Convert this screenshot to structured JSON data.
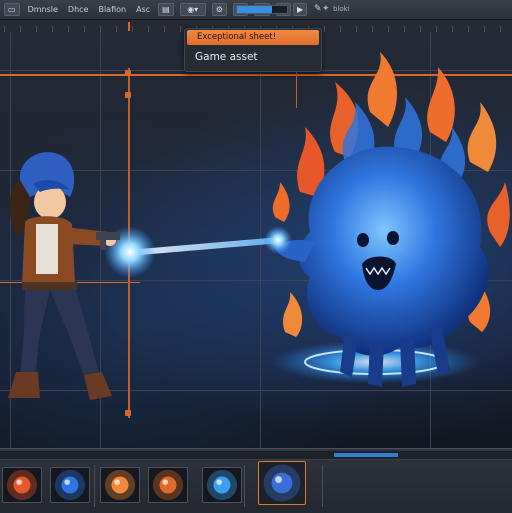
{
  "toolbar": {
    "menu_items": [
      "Dmnsle",
      "Dhce",
      "Blafion",
      "Asc"
    ],
    "right_text": "bloki",
    "progress_fraction": 0.7
  },
  "popup": {
    "header": "Exceptional sheet!",
    "item": "Game asset"
  },
  "timeline": {
    "thumbnails": [
      {
        "name": "fire-orb",
        "color": "#e8572a"
      },
      {
        "name": "blue-orb",
        "color": "#2f76e0"
      },
      {
        "name": "fire-blast",
        "color": "#f08a3a"
      },
      {
        "name": "orange-planet",
        "color": "#e06a2a"
      },
      {
        "name": "blue-sphere",
        "color": "#3aa0f0"
      },
      {
        "name": "ghost-sprite",
        "color": "#3a6fd8"
      }
    ],
    "selected_index": 5
  },
  "colors": {
    "accent": "#d9682a",
    "highlight_blue": "#3a8fe0"
  }
}
